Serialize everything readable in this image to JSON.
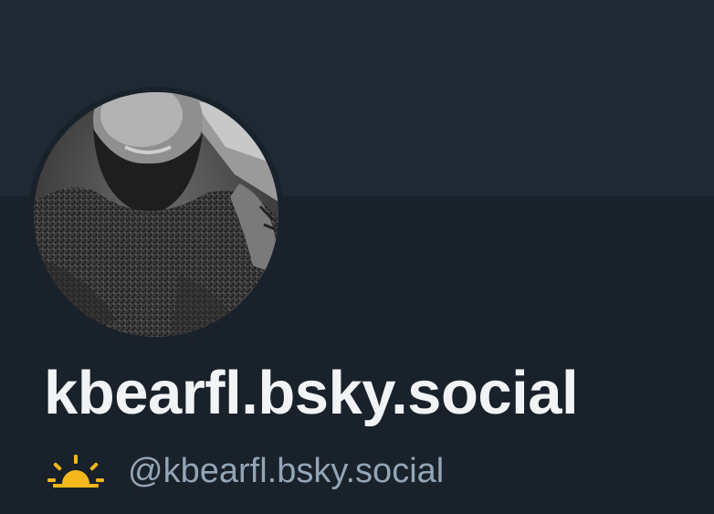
{
  "profile": {
    "display_name": "kbearfl.bsky.social",
    "handle": "@kbearfl.bsky.social",
    "status_icon": "sunrise-icon",
    "avatar_alt": "profile-avatar"
  },
  "colors": {
    "background": "#19212a",
    "banner": "#1e2935",
    "display_name": "#f1f3f5",
    "handle": "#93a5b7",
    "sun": "#f5b81c"
  }
}
